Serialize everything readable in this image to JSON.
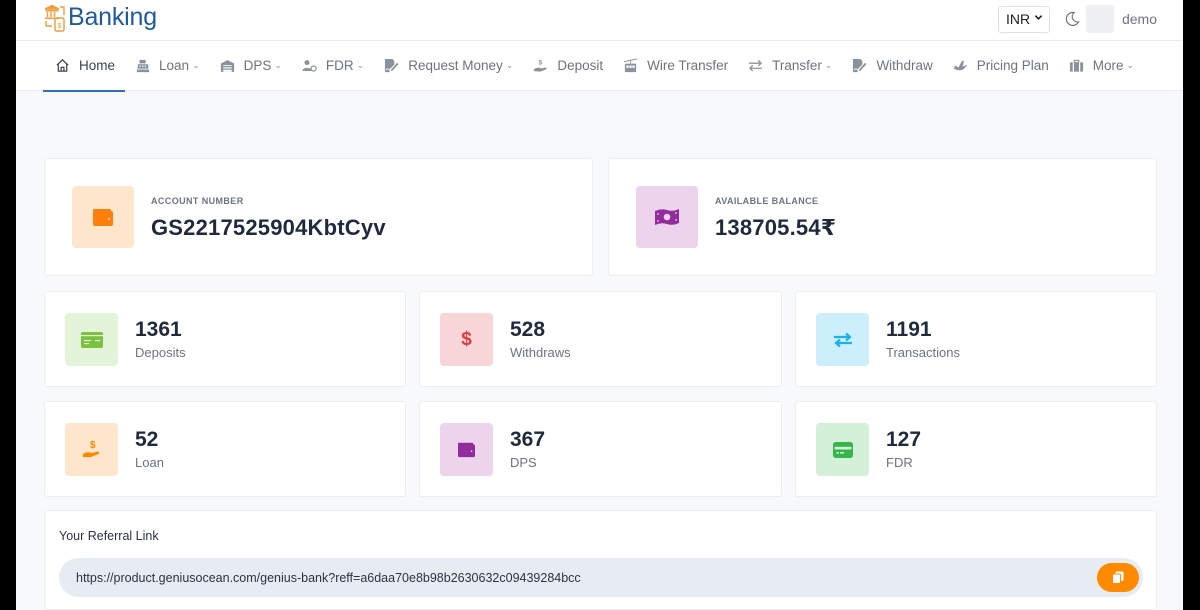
{
  "brand": {
    "name": "Banking",
    "logo_icon": "bank-mobile-icon"
  },
  "header": {
    "currency": {
      "selected": "INR"
    },
    "theme_toggle_icon": "moon-icon",
    "user": {
      "name": "demo"
    }
  },
  "nav": {
    "items": [
      {
        "label": "Home",
        "icon": "home-icon",
        "dropdown": false,
        "active": true
      },
      {
        "label": "Loan",
        "icon": "cash-register-icon",
        "dropdown": true
      },
      {
        "label": "DPS",
        "icon": "warehouse-icon",
        "dropdown": true
      },
      {
        "label": "FDR",
        "icon": "user-coin-icon",
        "dropdown": true
      },
      {
        "label": "Request Money",
        "icon": "file-signature-icon",
        "dropdown": true
      },
      {
        "label": "Deposit",
        "icon": "hand-dollar-icon",
        "dropdown": false
      },
      {
        "label": "Wire Transfer",
        "icon": "cable-car-icon",
        "dropdown": false
      },
      {
        "label": "Transfer",
        "icon": "exchange-arrows-icon",
        "dropdown": true
      },
      {
        "label": "Withdraw",
        "icon": "file-signature-icon",
        "dropdown": false
      },
      {
        "label": "Pricing Plan",
        "icon": "hand-holding-icon",
        "dropdown": false
      },
      {
        "label": "More",
        "icon": "briefcase-icon",
        "dropdown": true
      }
    ],
    "caret": "⌄"
  },
  "account": {
    "label": "ACCOUNT NUMBER",
    "value": "GS2217525904KbtCyv",
    "icon": "wallet-icon",
    "color": "#ff7f0e",
    "bg": "#fde6cc"
  },
  "balance": {
    "label": "AVAILABLE BALANCE",
    "value": "138705.54₹",
    "icon": "money-bill-icon",
    "color": "#922b9c",
    "bg": "#ecd5ec"
  },
  "stats": [
    {
      "value": "1361",
      "label": "Deposits",
      "icon": "credit-card-icon",
      "color": "#7ac142",
      "bg": "#e4f4d9"
    },
    {
      "value": "528",
      "label": "Withdraws",
      "icon": "dollar-icon",
      "color": "#e0393e",
      "bg": "#f8d6d8"
    },
    {
      "value": "1191",
      "label": "Transactions",
      "icon": "exchange-icon",
      "color": "#1eaee8",
      "bg": "#cdeffb"
    },
    {
      "value": "52",
      "label": "Loan",
      "icon": "hand-dollar-icon",
      "color": "#ff8500",
      "bg": "#fde6cc"
    },
    {
      "value": "367",
      "label": "DPS",
      "icon": "wallet-icon",
      "color": "#922b9c",
      "bg": "#ecd5ec"
    },
    {
      "value": "127",
      "label": "FDR",
      "icon": "credit-card-icon",
      "color": "#36b54a",
      "bg": "#d4f0d8"
    }
  ],
  "referral": {
    "title": "Your Referral Link",
    "link": "https://product.geniusocean.com/genius-bank?reff=a6daa70e8b98b2630632c09439284bcc",
    "copy_icon": "copy-icon",
    "copy_color": "#ff8a00"
  }
}
